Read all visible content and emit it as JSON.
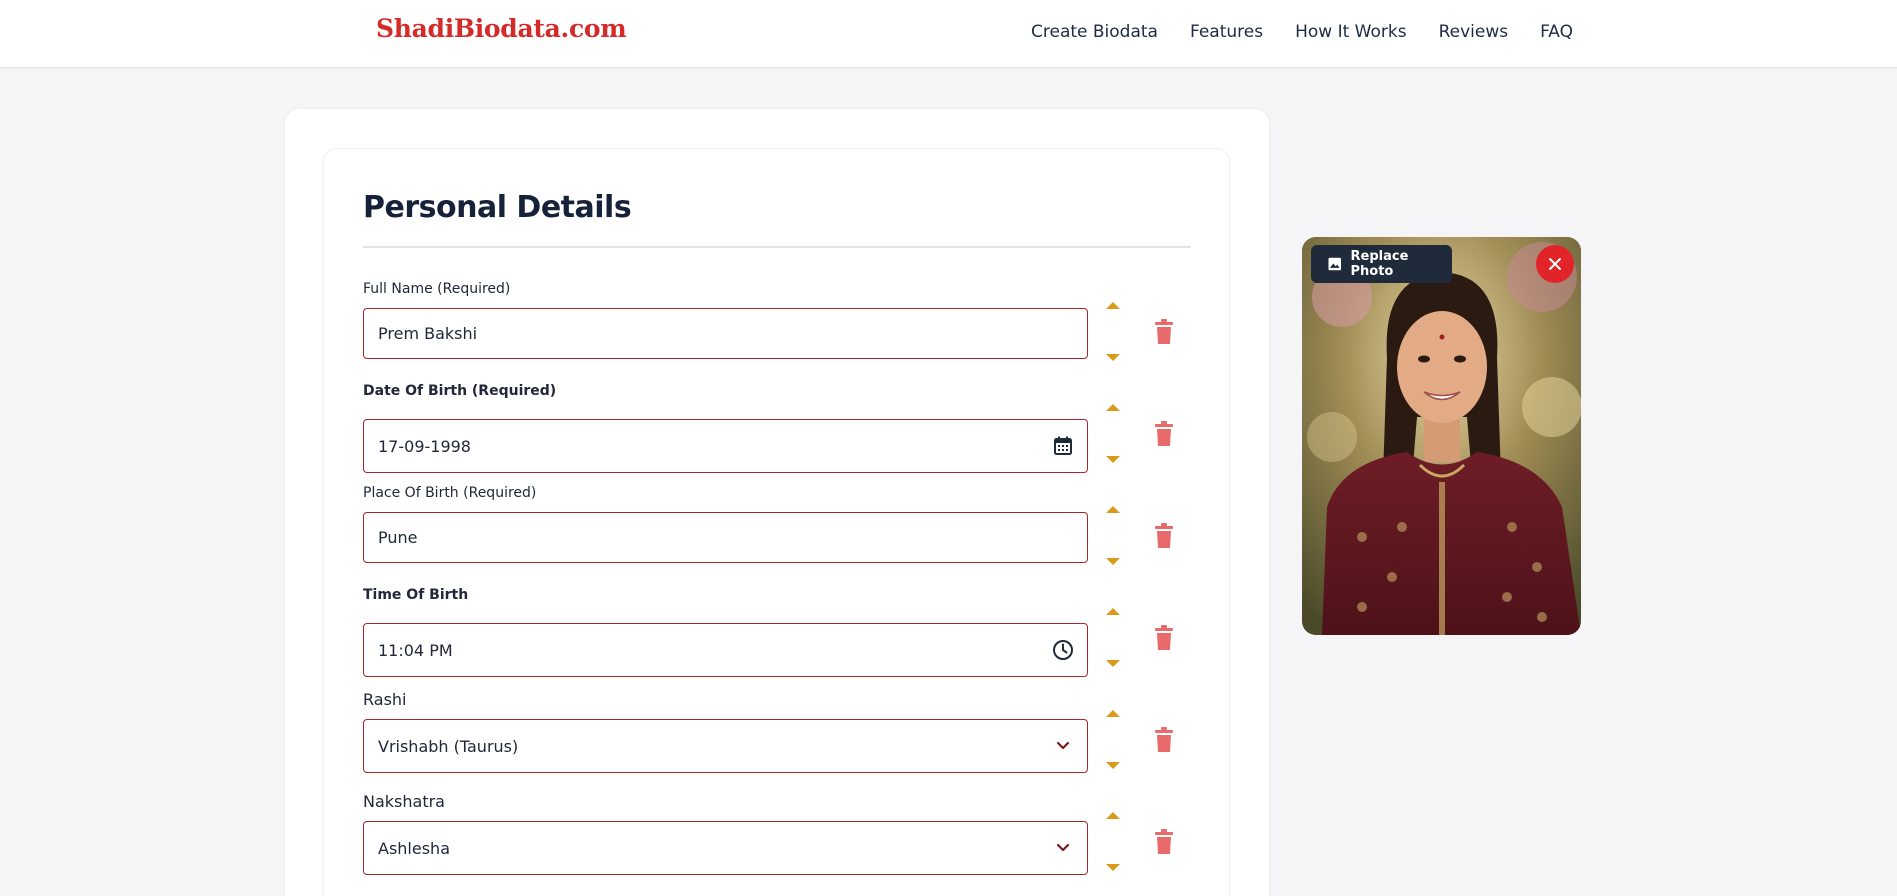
{
  "header": {
    "logo": "ShadiBiodata.com",
    "nav": [
      "Create Biodata",
      "Features",
      "How It Works",
      "Reviews",
      "FAQ"
    ]
  },
  "section": {
    "title": "Personal Details"
  },
  "fields": [
    {
      "label": "Full Name (Required)",
      "value": "Prem Bakshi",
      "type": "text"
    },
    {
      "label": "Date Of Birth (Required)",
      "value": "17-09-1998",
      "type": "date",
      "trail_icon": "calendar-icon"
    },
    {
      "label": "Place Of Birth (Required)",
      "value": "Pune",
      "type": "text"
    },
    {
      "label": "Time Of Birth",
      "value": "11:04 PM",
      "type": "time",
      "trail_icon": "clock-icon"
    },
    {
      "label": "Rashi",
      "value": "Vrishabh (Taurus)",
      "type": "select",
      "trail_icon": "chevron-down-icon"
    },
    {
      "label": "Nakshatra",
      "value": "Ashlesha",
      "type": "select",
      "trail_icon": "chevron-down-icon"
    }
  ],
  "photo": {
    "replace_label": "Replace Photo",
    "replace_icon": "image-icon",
    "close_icon": "close-icon"
  },
  "colors": {
    "brand": "#d42a2a",
    "field_border": "#a8252e",
    "arrow": "#d99b18",
    "trash": "#e86a6a",
    "close": "#e0242a",
    "replace_bg": "#1f2a3a"
  }
}
